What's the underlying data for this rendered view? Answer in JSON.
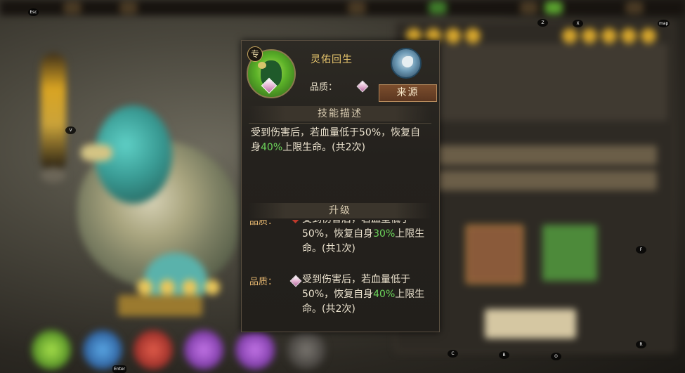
{
  "hotkeys": {
    "esc": "Esc",
    "v": "V",
    "z": "Z",
    "x": "X",
    "map": "map",
    "f": "F",
    "c": "C",
    "b": "B",
    "o": "O",
    "r": "R",
    "enter": "Enter"
  },
  "tooltip": {
    "skill_name": "灵佑回生",
    "badge": "专",
    "quality_label": "品质：",
    "source_button": "来源",
    "section_desc": "技能描述",
    "desc": {
      "part1": "受到伤害后，若血量低于50%，恢复自身",
      "percent": "40%",
      "part2": "上限生命。(共2次)"
    },
    "section_upgrade": "升级",
    "upgrades": [
      {
        "label": "品质：",
        "part1": "受到伤害后，若血量低于50%，恢复自身",
        "percent": "30%",
        "part2": "上限生命。(共1次)"
      },
      {
        "label": "品质：",
        "part1": "受到伤害后，若血量低于50%，恢复自身",
        "percent": "40%",
        "part2": "上限生命。(共2次)"
      }
    ]
  },
  "colors": {
    "accent_gold": "#e8c66d",
    "highlight_green": "#6cd35a",
    "source_button": "#7c4e2d"
  }
}
